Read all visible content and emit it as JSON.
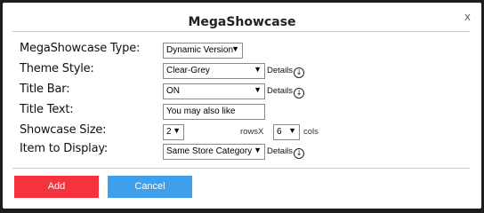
{
  "dialog": {
    "title": "MegaShowcase",
    "close_label": "x"
  },
  "fields": {
    "type": {
      "label": "MegaShowcase Type:",
      "value": "Dynamic Version"
    },
    "theme": {
      "label": "Theme Style:",
      "value": "Clear-Grey",
      "details": "Details"
    },
    "titlebar": {
      "label": "Title Bar:",
      "value": "ON",
      "details": "Details"
    },
    "titletext": {
      "label": "Title Text:",
      "value": "You may also like"
    },
    "size": {
      "label": "Showcase Size:",
      "rows": "2",
      "rows_label": "rowsX",
      "cols": "6",
      "cols_label": "cols"
    },
    "items": {
      "label": "Item to Display:",
      "value": "Same Store Category",
      "details": "Details"
    }
  },
  "buttons": {
    "add": "Add",
    "cancel": "Cancel"
  },
  "colors": {
    "add": "#f7323f",
    "cancel": "#3f9fea"
  },
  "icons": {
    "dropdown": "chevron-down-icon",
    "details": "arrow-down-circle-icon"
  }
}
